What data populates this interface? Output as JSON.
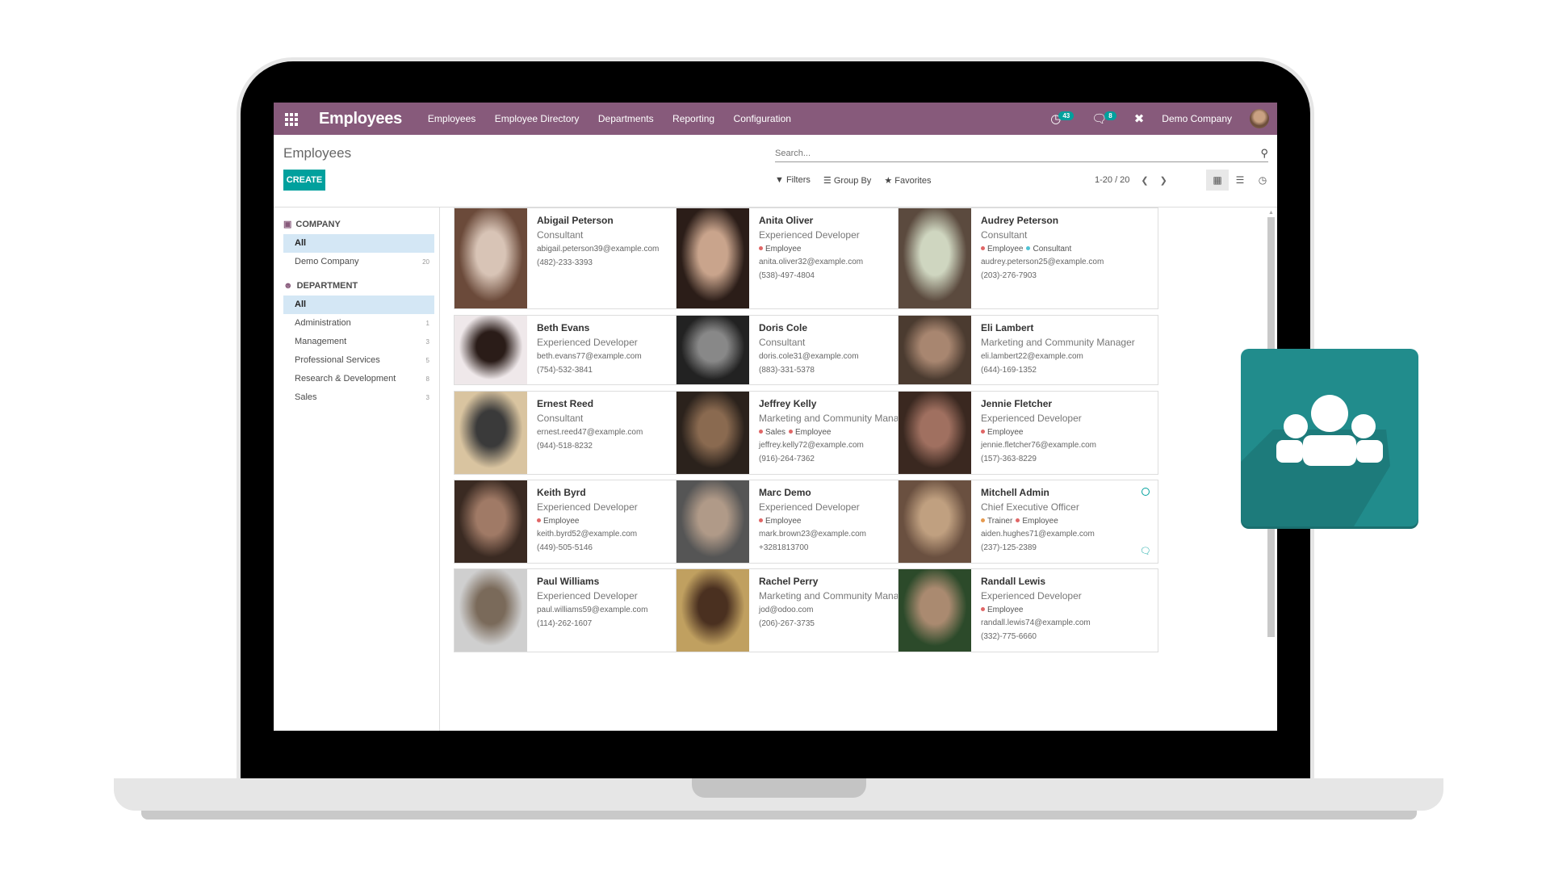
{
  "navbar": {
    "app_title": "Employees",
    "menu": [
      "Employees",
      "Employee Directory",
      "Departments",
      "Reporting",
      "Configuration"
    ],
    "activity_badge": "43",
    "messages_badge": "8",
    "company": "Demo Company",
    "color": "#875A7B"
  },
  "control_panel": {
    "breadcrumb": "Employees",
    "create_label": "CREATE",
    "search_placeholder": "Search...",
    "filters_label": "Filters",
    "groupby_label": "Group By",
    "favorites_label": "Favorites",
    "pager": "1-20 / 20",
    "accent": "#00A09D"
  },
  "sidebar": {
    "company_title": "COMPANY",
    "company_items": [
      {
        "label": "All",
        "count": "",
        "active": true
      },
      {
        "label": "Demo Company",
        "count": "20",
        "active": false
      }
    ],
    "department_title": "DEPARTMENT",
    "department_items": [
      {
        "label": "All",
        "count": "",
        "active": true
      },
      {
        "label": "Administration",
        "count": "1",
        "active": false
      },
      {
        "label": "Management",
        "count": "3",
        "active": false
      },
      {
        "label": "Professional Services",
        "count": "5",
        "active": false
      },
      {
        "label": "Research & Development",
        "count": "8",
        "active": false
      },
      {
        "label": "Sales",
        "count": "3",
        "active": false
      }
    ]
  },
  "tag_colors": {
    "Employee": "#e06666",
    "Consultant": "#4fc3d4",
    "Sales": "#e06666",
    "Trainer": "#e69a4f"
  },
  "employees": [
    {
      "name": "Abigail Peterson",
      "job": "Consultant",
      "tags": [],
      "email": "abigail.peterson39@example.com",
      "phone": "(482)-233-3393",
      "presence": "",
      "chat": false
    },
    {
      "name": "Anita Oliver",
      "job": "Experienced Developer",
      "tags": [
        "Employee"
      ],
      "email": "anita.oliver32@example.com",
      "phone": "(538)-497-4804",
      "presence": "",
      "chat": false
    },
    {
      "name": "Audrey Peterson",
      "job": "Consultant",
      "tags": [
        "Employee",
        "Consultant"
      ],
      "email": "audrey.peterson25@example.com",
      "phone": "(203)-276-7903",
      "presence": "",
      "chat": false
    },
    {
      "name": "Beth Evans",
      "job": "Experienced Developer",
      "tags": [],
      "email": "beth.evans77@example.com",
      "phone": "(754)-532-3841",
      "presence": "",
      "chat": false
    },
    {
      "name": "Doris Cole",
      "job": "Consultant",
      "tags": [],
      "email": "doris.cole31@example.com",
      "phone": "(883)-331-5378",
      "presence": "",
      "chat": false
    },
    {
      "name": "Eli Lambert",
      "job": "Marketing and Community Manager",
      "tags": [],
      "email": "eli.lambert22@example.com",
      "phone": "(644)-169-1352",
      "presence": "",
      "chat": false
    },
    {
      "name": "Ernest Reed",
      "job": "Consultant",
      "tags": [],
      "email": "ernest.reed47@example.com",
      "phone": "(944)-518-8232",
      "presence": "",
      "chat": false
    },
    {
      "name": "Jeffrey Kelly",
      "job": "Marketing and Community Manager",
      "tags": [
        "Sales",
        "Employee"
      ],
      "email": "jeffrey.kelly72@example.com",
      "phone": "(916)-264-7362",
      "presence": "",
      "chat": false
    },
    {
      "name": "Jennie Fletcher",
      "job": "Experienced Developer",
      "tags": [
        "Employee"
      ],
      "email": "jennie.fletcher76@example.com",
      "phone": "(157)-363-8229",
      "presence": "",
      "chat": false
    },
    {
      "name": "Keith Byrd",
      "job": "Experienced Developer",
      "tags": [
        "Employee"
      ],
      "email": "keith.byrd52@example.com",
      "phone": "(449)-505-5146",
      "presence": "",
      "chat": false
    },
    {
      "name": "Marc Demo",
      "job": "Experienced Developer",
      "tags": [
        "Employee"
      ],
      "email": "mark.brown23@example.com",
      "phone": "+3281813700",
      "presence": "offline",
      "chat": true
    },
    {
      "name": "Mitchell Admin",
      "job": "Chief Executive Officer",
      "tags": [
        "Trainer",
        "Employee"
      ],
      "email": "aiden.hughes71@example.com",
      "phone": "(237)-125-2389",
      "presence": "online",
      "chat": true
    },
    {
      "name": "Paul Williams",
      "job": "Experienced Developer",
      "tags": [],
      "email": "paul.williams59@example.com",
      "phone": "(114)-262-1607",
      "presence": "",
      "chat": false
    },
    {
      "name": "Rachel Perry",
      "job": "Marketing and Community Manager",
      "tags": [],
      "email": "jod@odoo.com",
      "phone": "(206)-267-3735",
      "presence": "",
      "chat": false
    },
    {
      "name": "Randall Lewis",
      "job": "Experienced Developer",
      "tags": [
        "Employee"
      ],
      "email": "randall.lewis74@example.com",
      "phone": "(332)-775-6660",
      "presence": "",
      "chat": false
    }
  ],
  "app_tile": {
    "icon": "users-group-icon",
    "color": "#218c8c"
  }
}
